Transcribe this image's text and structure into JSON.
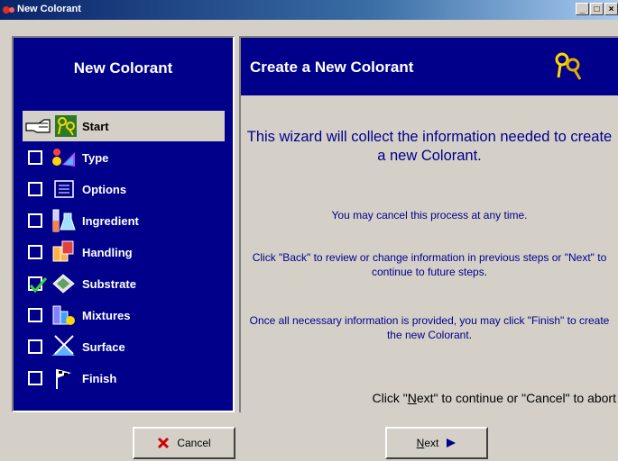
{
  "window": {
    "title": "New Colorant"
  },
  "left": {
    "title": "New Colorant",
    "steps": [
      {
        "label": "Start",
        "icon": "start-keys-icon",
        "state": "current"
      },
      {
        "label": "Type",
        "icon": "type-color-icon",
        "state": "unchecked"
      },
      {
        "label": "Options",
        "icon": "options-list-icon",
        "state": "unchecked"
      },
      {
        "label": "Ingredient",
        "icon": "ingredient-flask-icon",
        "state": "unchecked"
      },
      {
        "label": "Handling",
        "icon": "handling-box-icon",
        "state": "unchecked"
      },
      {
        "label": "Substrate",
        "icon": "substrate-layers-icon",
        "state": "checked"
      },
      {
        "label": "Mixtures",
        "icon": "mixtures-icon",
        "state": "unchecked"
      },
      {
        "label": "Surface",
        "icon": "surface-icon",
        "state": "unchecked"
      },
      {
        "label": "Finish",
        "icon": "finish-flag-icon",
        "state": "unchecked"
      }
    ]
  },
  "right": {
    "title": "Create a New Colorant",
    "header_icon": "keys-icon",
    "main_message": "This wizard will collect the information needed to create a new Colorant.",
    "cancel_message": "You may cancel this process at any time.",
    "back_message": "Click \"Back\" to review or change information in previous steps or \"Next\" to continue to future steps.",
    "finish_message": "Once all necessary information is provided, you may click \"Finish\" to create the new Colorant.",
    "bottom_pre": "Click \"",
    "bottom_key": "N",
    "bottom_post": "ext\" to continue or \"Cancel\" to abort"
  },
  "buttons": {
    "cancel": "Cancel",
    "next_key": "N",
    "next_rest": "ext"
  },
  "colors": {
    "panel": "#00008b",
    "face": "#d4d0c8"
  }
}
